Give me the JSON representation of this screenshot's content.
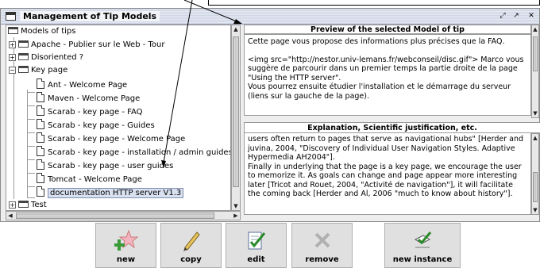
{
  "window": {
    "title": "Management of Tip Models",
    "controls": [
      "⤢",
      "↗",
      "✕"
    ]
  },
  "tree": {
    "root": "Models of tips",
    "items": [
      {
        "label": "Apache - Publier sur le Web - Tour",
        "type": "folder",
        "expander": "+"
      },
      {
        "label": "Disoriented ?",
        "type": "folder",
        "expander": "+"
      },
      {
        "label": "Key page",
        "type": "folder",
        "expander": "−"
      },
      {
        "label": "Ant - Welcome Page",
        "type": "doc"
      },
      {
        "label": "Maven - Welcome Page",
        "type": "doc"
      },
      {
        "label": "Scarab - key page - FAQ",
        "type": "doc"
      },
      {
        "label": "Scarab - key page - Guides",
        "type": "doc"
      },
      {
        "label": "Scarab - key page - Welcome Page",
        "type": "doc"
      },
      {
        "label": "Scarab - key page - installation / admin guides",
        "type": "doc"
      },
      {
        "label": "Scarab - key page - user guides",
        "type": "doc"
      },
      {
        "label": "Tomcat - Welcome Page",
        "type": "doc"
      },
      {
        "label": "documentation HTTP server V1.3",
        "type": "doc",
        "selected": true
      },
      {
        "label": "Test",
        "type": "folder",
        "expander": "+"
      }
    ]
  },
  "preview": {
    "heading": "Preview of the selected Model of tip",
    "paragraphs": [
      "Cette page vous propose des informations plus précises que la FAQ.",
      "<img src=\"http://nestor.univ-lemans.fr/webconseil/disc.gif\"> Marco vous suggère de parcourir dans un premier temps la partie droite de la page \"Using the HTTP server\".",
      "Vous pourrez ensuite étudier l'installation et le démarrage du serveur (liens sur la gauche de la page)."
    ]
  },
  "explanation": {
    "heading": "Explanation, Scientific justification, etc.",
    "paragraphs": [
      "users often return to pages that serve as navigational hubs\" [Herder and juvina, 2004, \"Discovery of Individual User Navigation Styles. Adaptive Hypermedia AH2004\"].",
      "Finally in underlying that the page is a key page, we encourage the user to memorize it. As goals can change and page appear more interesting later [Tricot and Rouet, 2004, \"Activité de navigation\"], it will facilitate the coming back [Herder and Al, 2006 \"much to know about history\"]."
    ]
  },
  "toolbar": {
    "new_label": "new",
    "copy_label": "copy",
    "edit_label": "edit",
    "remove_label": "remove",
    "new_instance_label": "new instance"
  },
  "colors": {
    "frame_bg": "#eeeeee",
    "selection_bg": "#d8e1f0",
    "button_bg": "#e0e0e0"
  }
}
